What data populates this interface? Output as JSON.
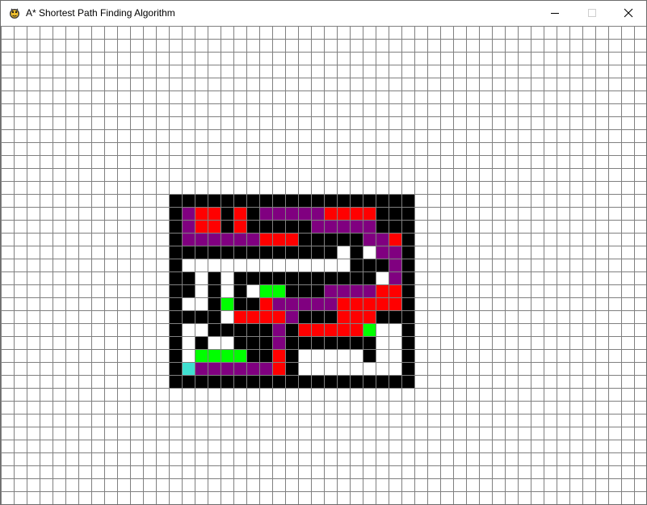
{
  "window": {
    "title": "A* Shortest Path Finding Algorithm",
    "app_icon": "pygame-snake-icon",
    "controls": {
      "minimize_icon": "minimize-icon",
      "maximize_icon": "maximize-icon",
      "close_icon": "close-icon"
    }
  },
  "grid": {
    "rows": 38,
    "cols": 50,
    "colors": {
      ".": "#ffffff",
      "B": "#000000",
      "P": "#800080",
      "R": "#ff0000",
      "G": "#00ff00",
      "T": "#40e0d0",
      "line": "#808080"
    },
    "cells": [
      "..................................................",
      "..................................................",
      "..................................................",
      "..................................................",
      "..................................................",
      "..................................................",
      "..................................................",
      "..................................................",
      "..................................................",
      "..................................................",
      "..................................................",
      "..................................................",
      "..................................................",
      ".............BBBBBBBBBBBBBBBBBBB..................",
      ".............BPRRBRBPPPPPRRRRBBB..................",
      ".............BPRRBRBBBBBPPPPPBBB..................",
      ".............BPPPPPPRRRBBBBBPPRB..................",
      ".............BBBBBBBBBBBBB.B.PPB..................",
      ".............B.............BBBPB..................",
      ".............BB.B.BBBBBBBBBBB.PB..................",
      ".............BB.B.B.GGBBBPPPPRRB..................",
      ".............B..BGBBRPPPPPRRRRRB..................",
      ".............BBBB.RRRRPBBBRRRBBB..................",
      ".............B..BBBBBPBRRRRRG..B..................",
      ".............B.B..BBBPBBBBBBB..B..................",
      ".............B.GGGGBBRB.....B..B..................",
      ".............BTPPPPPPRB........B..................",
      ".............BBBBBBBBBBBBBBBBBBB..................",
      "..................................................",
      "..................................................",
      "..................................................",
      "..................................................",
      "..................................................",
      "..................................................",
      "..................................................",
      "..................................................",
      "..................................................",
      ".................................................."
    ]
  }
}
